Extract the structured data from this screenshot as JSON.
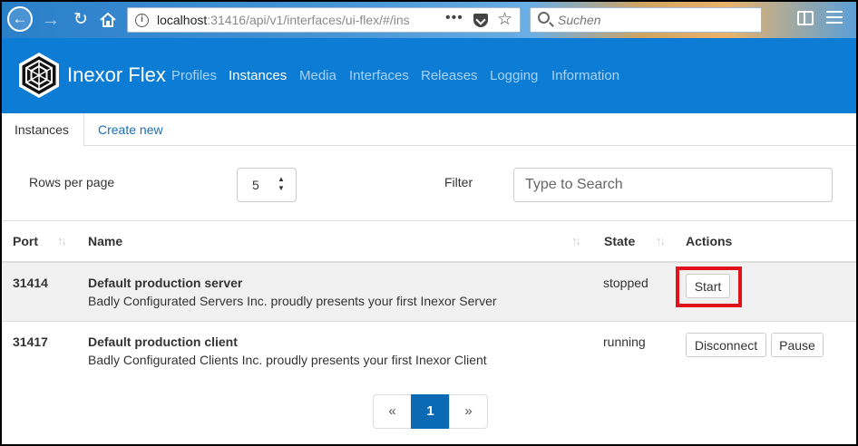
{
  "browser": {
    "url_host": "localhost",
    "url_rest": ":31416/api/v1/interfaces/ui-flex/#/ins",
    "search_placeholder": "Suchen",
    "more_glyph": "•••"
  },
  "app": {
    "brand": "Inexor Flex",
    "nav": [
      "Profiles",
      "Instances",
      "Media",
      "Interfaces",
      "Releases",
      "Logging",
      "Information"
    ],
    "active_nav": "Instances",
    "accent_color": "#0c7cd5"
  },
  "tabs": {
    "instances": "Instances",
    "create_new": "Create new"
  },
  "controls": {
    "rows_label": "Rows per page",
    "rows_value": "5",
    "filter_label": "Filter",
    "filter_placeholder": "Type to Search"
  },
  "table": {
    "headers": {
      "port": "Port",
      "name": "Name",
      "state": "State",
      "actions": "Actions"
    },
    "rows": [
      {
        "port": "31414",
        "name": "Default production server",
        "description": "Badly Configurated Servers Inc. proudly presents your first Inexor Server",
        "state": "stopped",
        "actions": [
          "Start"
        ]
      },
      {
        "port": "31417",
        "name": "Default production client",
        "description": "Badly Configurated Clients Inc. proudly presents your first Inexor Client",
        "state": "running",
        "actions": [
          "Disconnect",
          "Pause"
        ]
      }
    ]
  },
  "pagination": {
    "prev": "«",
    "current": "1",
    "next": "»"
  },
  "highlight_color": "#e0121b"
}
